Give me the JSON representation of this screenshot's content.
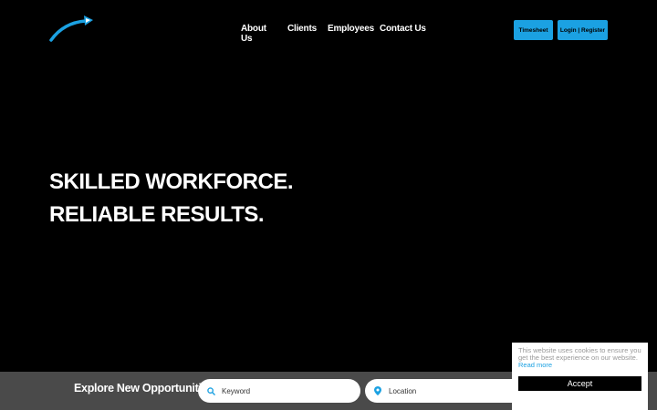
{
  "header": {
    "logo_icon": "swoosh-arrow-icon",
    "nav": [
      "About Us",
      "Clients",
      "Employees",
      "Contact Us"
    ],
    "timesheet_label": "Timesheet",
    "login_label": "Login | Register"
  },
  "hero": {
    "line1": "SKILLED WORKFORCE.",
    "line2": "RELIABLE RESULTS."
  },
  "search": {
    "title": "Explore New Opportunities",
    "keyword_placeholder": "Keyword",
    "location_placeholder": "Location",
    "keyword_icon": "search-icon",
    "location_icon": "map-pin-icon"
  },
  "cookie": {
    "text": "This website uses cookies to ensure you get the best experience on our website.",
    "read_more": "Read more",
    "accept_label": "Accept"
  },
  "colors": {
    "accent": "#1ba1e2",
    "background": "#000000",
    "search_bar": "#4a4a4a"
  }
}
